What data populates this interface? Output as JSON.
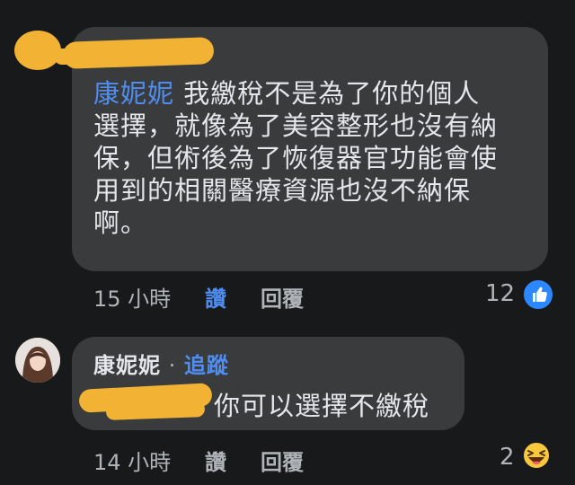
{
  "comment1": {
    "author": "康妮妮",
    "text_first": "我繳稅不是為了你的個人",
    "lines": [
      "選擇，就像為了美容整形也沒有納",
      "保，但術後為了恢復器官功能會使",
      "用到的相關醫療資源也沒不納保",
      "啊。"
    ],
    "time": "15 小時",
    "like_label": "讚",
    "reply_label": "回覆",
    "reaction_count": "12",
    "reaction_icon": "thumbs-up-icon"
  },
  "comment2": {
    "author": "康妮妮",
    "separator": "·",
    "follow_label": "追蹤",
    "text": "你可以選擇不繳稅",
    "time": "14 小時",
    "like_label": "讚",
    "reply_label": "回覆",
    "reaction_count": "2",
    "reaction_icon": "haha-emoji-icon"
  },
  "colors": {
    "background": "#18191a",
    "bubble": "#3a3b3c",
    "link_blue": "#4f8ef0",
    "redaction": "#f2b233"
  }
}
